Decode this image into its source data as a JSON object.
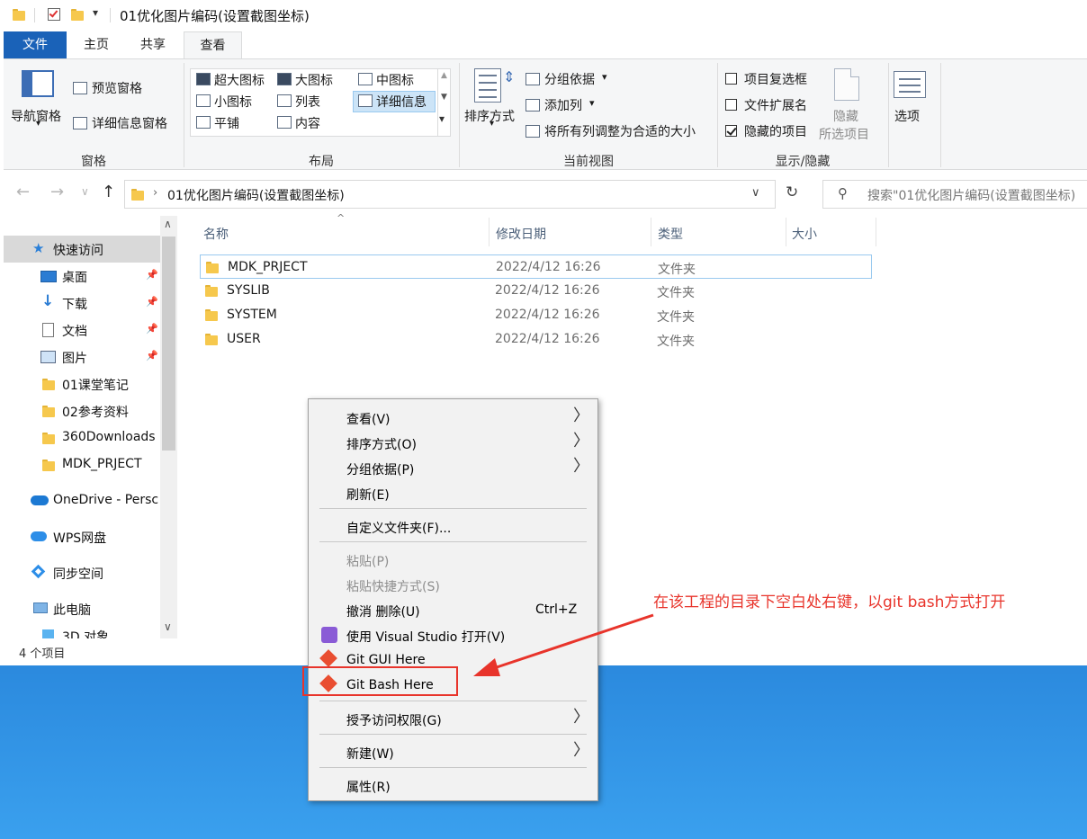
{
  "window": {
    "title": "01优化图片编码(设置截图坐标)",
    "tabs": [
      "文件",
      "主页",
      "共享",
      "查看"
    ]
  },
  "ribbon": {
    "panes": {
      "nav_pane": "导航窗格",
      "preview_pane": "预览窗格",
      "details_pane": "详细信息窗格",
      "group_label": "窗格"
    },
    "layout": {
      "items": [
        "超大图标",
        "大图标",
        "中图标",
        "小图标",
        "列表",
        "详细信息",
        "平铺",
        "内容"
      ],
      "selected": "详细信息",
      "group_label": "布局"
    },
    "current_view": {
      "sort_by": "排序方式",
      "group_by": "分组依据",
      "add_column": "添加列",
      "fit_columns": "将所有列调整为合适的大小",
      "group_label": "当前视图"
    },
    "show_hide": {
      "item_checkboxes": {
        "label": "项目复选框",
        "checked": false
      },
      "file_extensions": {
        "label": "文件扩展名",
        "checked": false
      },
      "hidden_items": {
        "label": "隐藏的项目",
        "checked": true
      },
      "hide_selected_1": "隐藏",
      "hide_selected_2": "所选项目",
      "group_label": "显示/隐藏"
    },
    "options": "选项"
  },
  "address": {
    "path": "01优化图片编码(设置截图坐标)",
    "search_placeholder": "搜索\"01优化图片编码(设置截图坐标)"
  },
  "nav_pane": {
    "quick_access": "快速访问",
    "items": [
      {
        "label": "桌面",
        "pinned": true
      },
      {
        "label": "下载",
        "pinned": true
      },
      {
        "label": "文档",
        "pinned": true
      },
      {
        "label": "图片",
        "pinned": true
      },
      {
        "label": "01课堂笔记",
        "pinned": false
      },
      {
        "label": "02参考资料",
        "pinned": false
      },
      {
        "label": "360Downloads",
        "pinned": false
      },
      {
        "label": "MDK_PRJECT",
        "pinned": false
      }
    ],
    "onedrive": "OneDrive - Persc",
    "wps": "WPS网盘",
    "sync": "同步空间",
    "this_pc": "此电脑",
    "objects3d": "3D 对象"
  },
  "file_list": {
    "columns": [
      "名称",
      "修改日期",
      "类型",
      "大小"
    ],
    "rows": [
      {
        "name": "MDK_PRJECT",
        "date": "2022/4/12 16:26",
        "type": "文件夹",
        "size": ""
      },
      {
        "name": "SYSLIB",
        "date": "2022/4/12 16:26",
        "type": "文件夹",
        "size": ""
      },
      {
        "name": "SYSTEM",
        "date": "2022/4/12 16:26",
        "type": "文件夹",
        "size": ""
      },
      {
        "name": "USER",
        "date": "2022/4/12 16:26",
        "type": "文件夹",
        "size": ""
      }
    ]
  },
  "status": "4 个项目",
  "context_menu": {
    "view": "查看(V)",
    "sort": "排序方式(O)",
    "group": "分组依据(P)",
    "refresh": "刷新(E)",
    "customize": "自定义文件夹(F)...",
    "paste": "粘贴(P)",
    "paste_shortcut": "粘贴快捷方式(S)",
    "undo": "撤消 删除(U)",
    "undo_shortcut": "Ctrl+Z",
    "open_vs": "使用 Visual Studio 打开(V)",
    "git_gui": "Git GUI Here",
    "git_bash": "Git Bash Here",
    "grant_access": "授予访问权限(G)",
    "new": "新建(W)",
    "properties": "属性(R)"
  },
  "annotation": "在该工程的目录下空白处右键，以git bash方式打开",
  "colors": {
    "accent": "#1a62b8",
    "annotation": "#e8342b",
    "folder": "#f6c84d"
  }
}
